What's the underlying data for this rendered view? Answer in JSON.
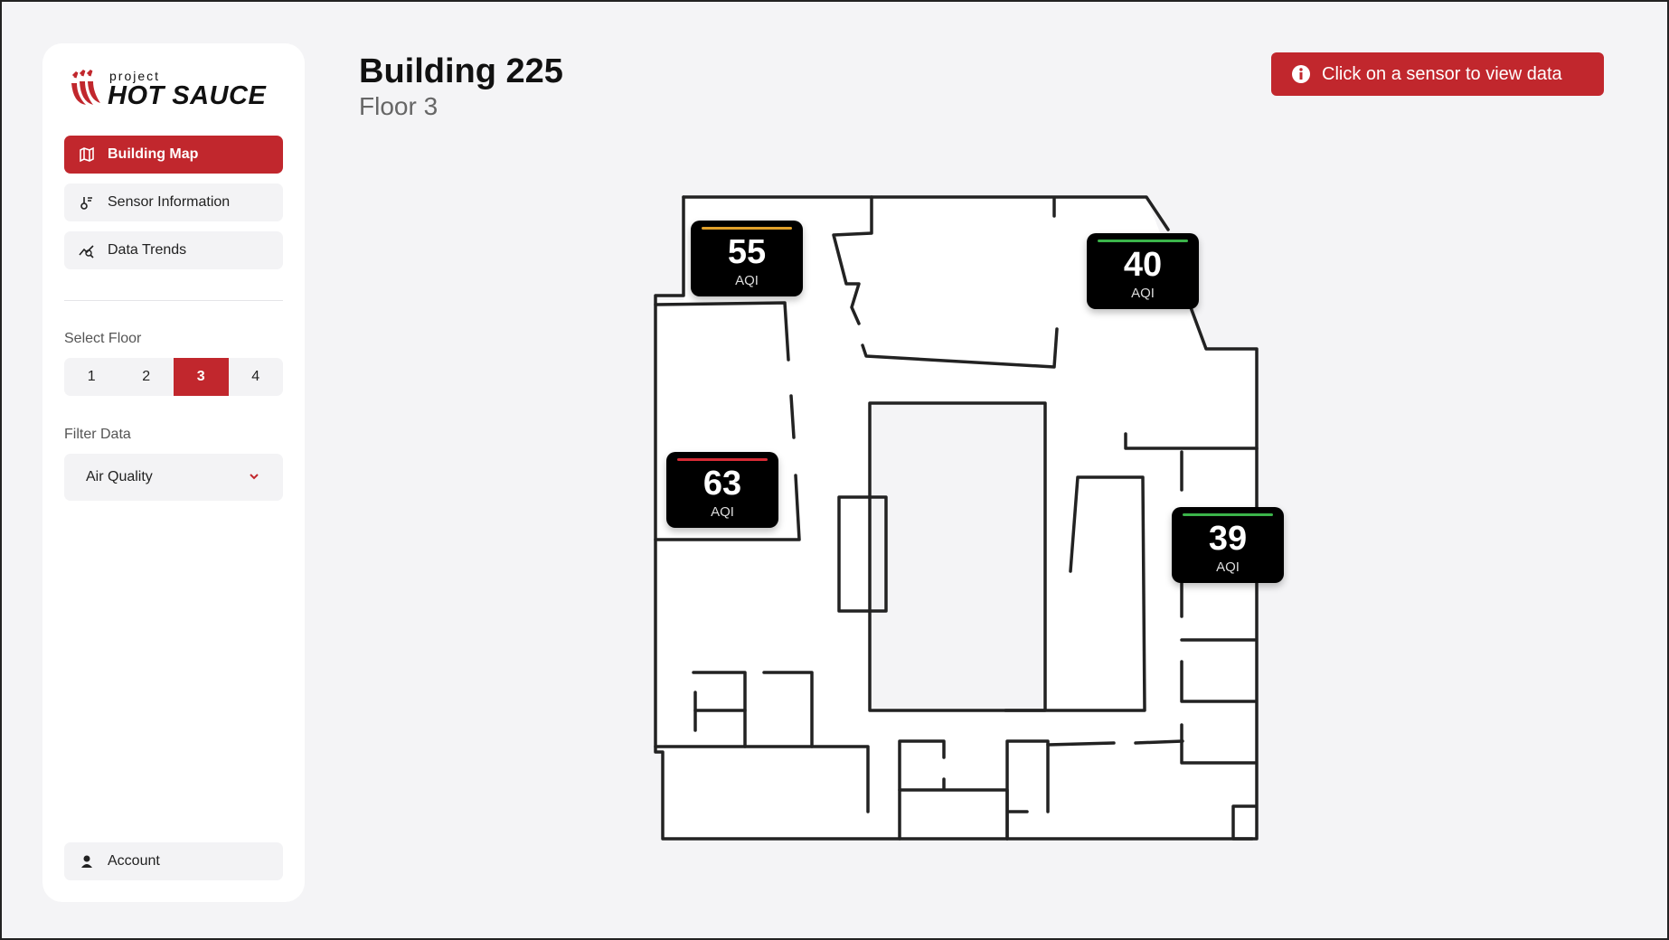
{
  "brand": {
    "small": "project",
    "big": "HOT SAUCE",
    "color": "#c1272d"
  },
  "nav": [
    {
      "label": "Building Map",
      "icon": "map-icon",
      "active": true
    },
    {
      "label": "Sensor Information",
      "icon": "thermometer-icon",
      "active": false
    },
    {
      "label": "Data Trends",
      "icon": "trend-icon",
      "active": false
    }
  ],
  "floor_select": {
    "label": "Select Floor",
    "options": [
      "1",
      "2",
      "3",
      "4"
    ],
    "selected": "3"
  },
  "filter": {
    "label": "Filter Data",
    "value": "Air Quality"
  },
  "account": {
    "label": "Account"
  },
  "header": {
    "title": "Building 225",
    "subtitle": "Floor 3"
  },
  "notice": {
    "text": "Click on a sensor to view data"
  },
  "sensors": [
    {
      "value": "55",
      "unit": "AQI",
      "status_color": "#e0a02a"
    },
    {
      "value": "40",
      "unit": "AQI",
      "status_color": "#3bb44a"
    },
    {
      "value": "63",
      "unit": "AQI",
      "status_color": "#d62b35"
    },
    {
      "value": "39",
      "unit": "AQI",
      "status_color": "#3bb44a"
    }
  ]
}
